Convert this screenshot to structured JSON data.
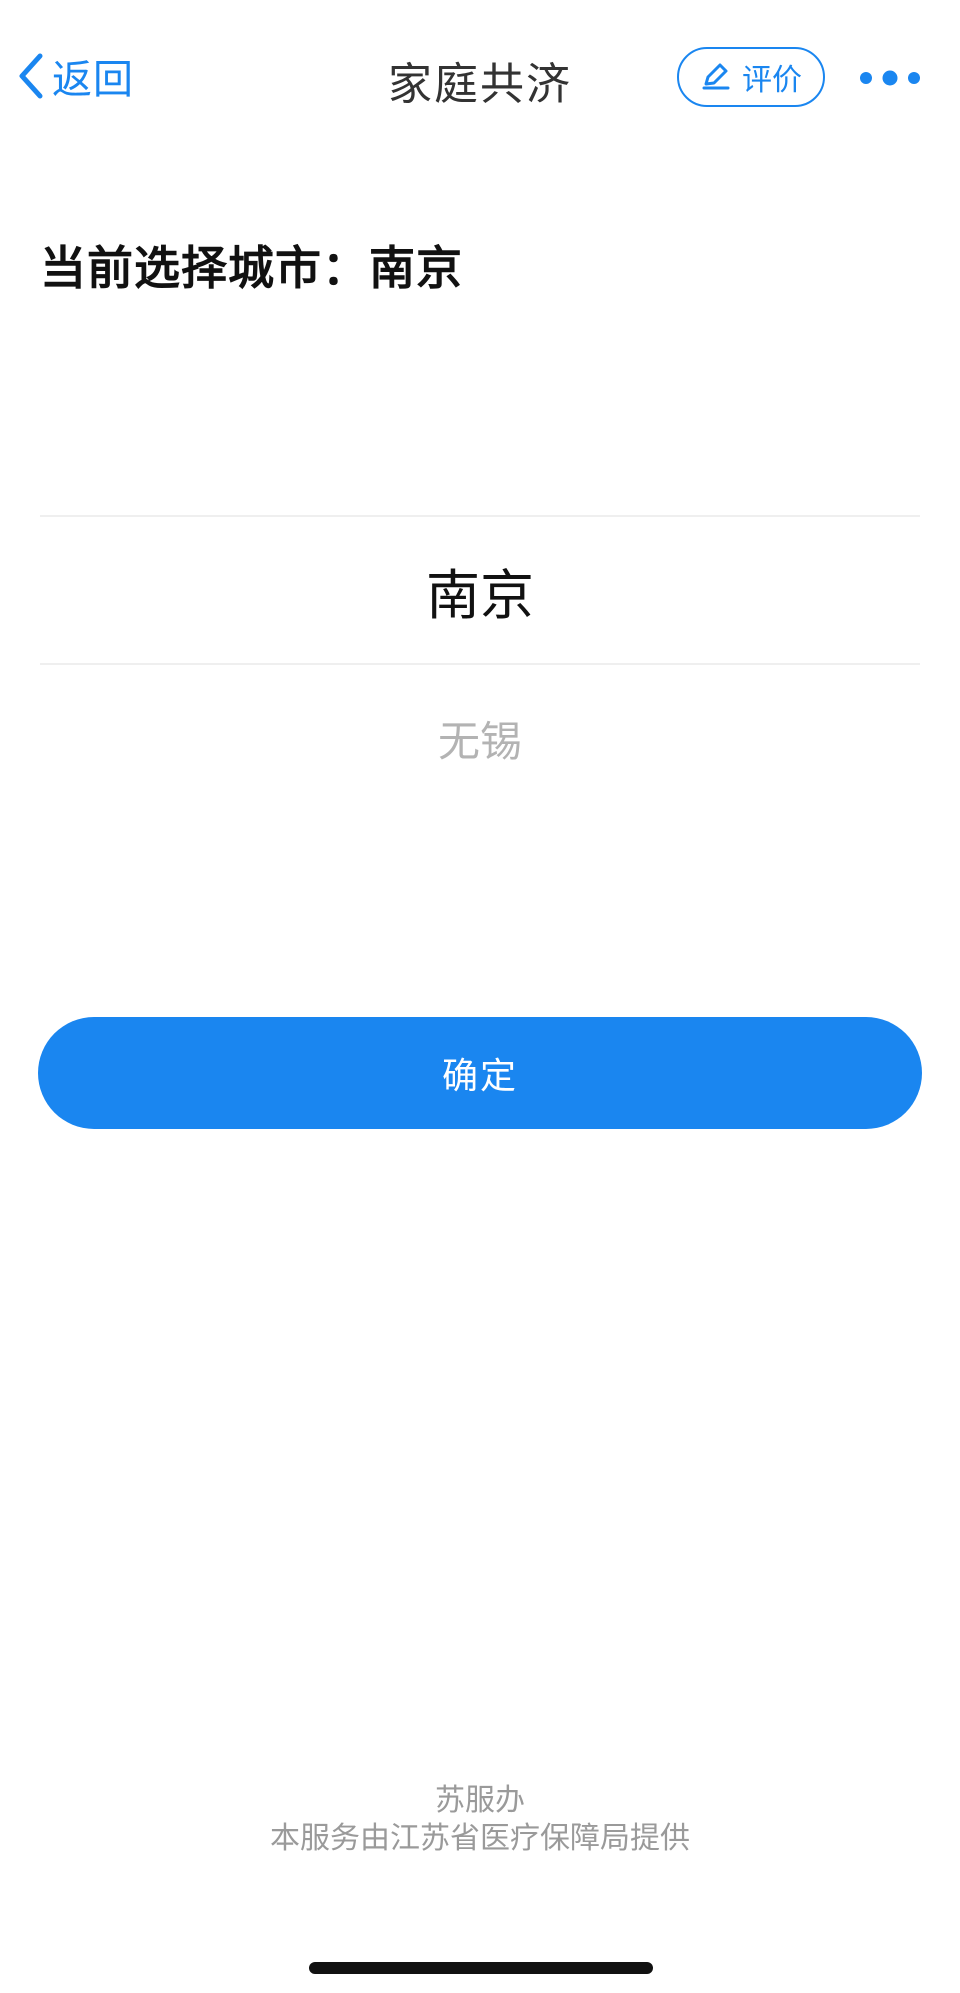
{
  "nav": {
    "back_label": "返回",
    "title": "家庭共济",
    "rate_label": "评价",
    "accent_color": "#1a86f0"
  },
  "current_city": {
    "text": "当前选择城市：南京"
  },
  "picker": {
    "selected": "南京",
    "options": [
      "无锡"
    ]
  },
  "confirm": {
    "label": "确定"
  },
  "footer": {
    "line1": "苏服办",
    "line2": "本服务由江苏省医疗保障局提供"
  },
  "icons": {
    "back": "chevron-left-icon",
    "rate": "edit-pencil-icon",
    "more": "more-dots-icon"
  }
}
